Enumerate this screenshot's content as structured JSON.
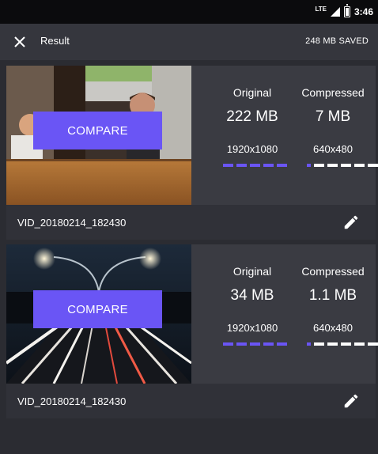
{
  "status": {
    "network": "LTE",
    "time": "3:46"
  },
  "appbar": {
    "title": "Result",
    "saved": "248 MB SAVED"
  },
  "videos": [
    {
      "compare_label": "COMPARE",
      "original_label": "Original",
      "compressed_label": "Compressed",
      "original_size": "222 MB",
      "compressed_size": "7 MB",
      "original_resolution": "1920x1080",
      "compressed_resolution": "640x480",
      "file_name": "VID_20180214_182430"
    },
    {
      "compare_label": "COMPARE",
      "original_label": "Original",
      "compressed_label": "Compressed",
      "original_size": "34 MB",
      "compressed_size": "1.1 MB",
      "original_resolution": "1920x1080",
      "compressed_resolution": "640x480",
      "file_name": "VID_20180214_182430"
    }
  ],
  "colors": {
    "accent": "#6a55f5",
    "background": "#2b2c32",
    "card": "#3a3b42",
    "appbar": "#35363d"
  },
  "icons": {
    "close": "close-icon",
    "edit": "pencil-icon",
    "battery": "battery-icon",
    "signal": "signal-icon"
  }
}
